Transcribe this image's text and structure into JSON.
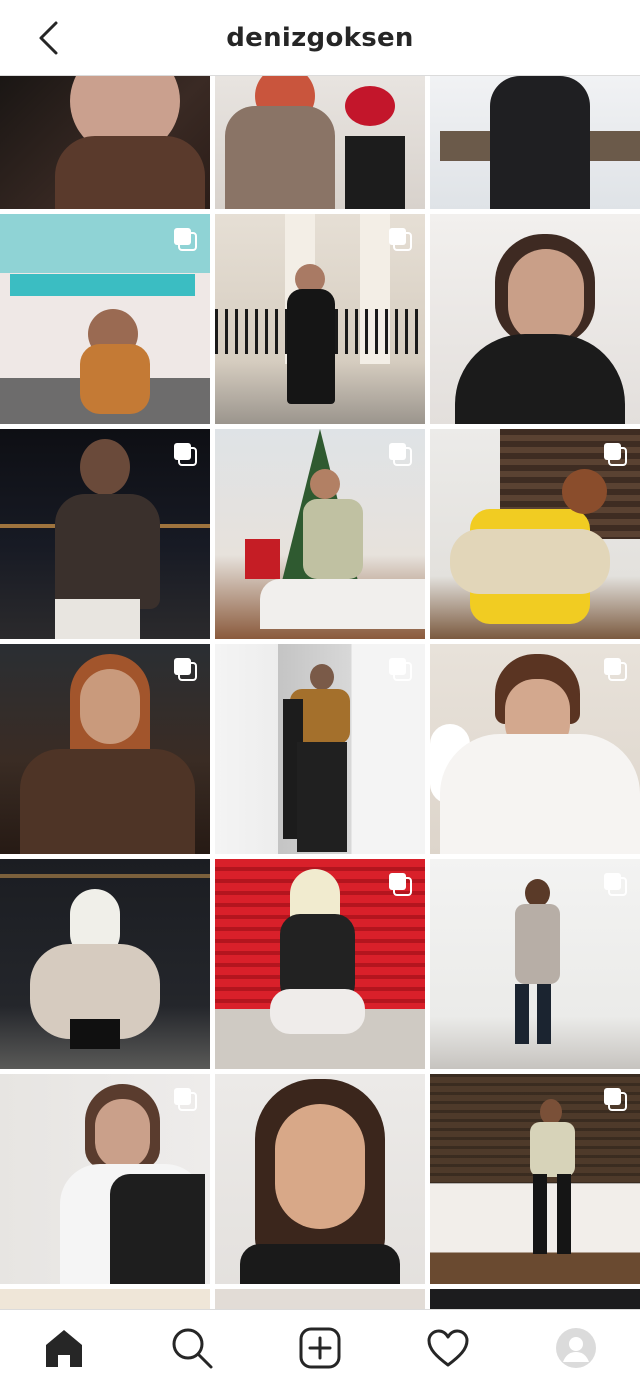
{
  "header": {
    "username": "denizgoksen",
    "back_icon": "chevron-left-icon"
  },
  "grid": {
    "multi_post_icon": "carousel-icon",
    "tiles": [
      {
        "row": 1,
        "col": 1,
        "multi": false
      },
      {
        "row": 1,
        "col": 2,
        "multi": false
      },
      {
        "row": 1,
        "col": 3,
        "multi": false
      },
      {
        "row": 2,
        "col": 1,
        "multi": true
      },
      {
        "row": 2,
        "col": 2,
        "multi": true
      },
      {
        "row": 2,
        "col": 3,
        "multi": false
      },
      {
        "row": 3,
        "col": 1,
        "multi": true
      },
      {
        "row": 3,
        "col": 2,
        "multi": true
      },
      {
        "row": 3,
        "col": 3,
        "multi": true
      },
      {
        "row": 4,
        "col": 1,
        "multi": true
      },
      {
        "row": 4,
        "col": 2,
        "multi": true
      },
      {
        "row": 4,
        "col": 3,
        "multi": true
      },
      {
        "row": 5,
        "col": 1,
        "multi": false
      },
      {
        "row": 5,
        "col": 2,
        "multi": true
      },
      {
        "row": 5,
        "col": 3,
        "multi": true
      },
      {
        "row": 6,
        "col": 1,
        "multi": true
      },
      {
        "row": 6,
        "col": 2,
        "multi": false
      },
      {
        "row": 6,
        "col": 3,
        "multi": true
      },
      {
        "row": 7,
        "col": 1,
        "multi": true
      },
      {
        "row": 7,
        "col": 2,
        "multi": true
      },
      {
        "row": 7,
        "col": 3,
        "multi": false
      }
    ]
  },
  "bottom_nav": {
    "items": [
      {
        "icon": "home-icon",
        "active": true
      },
      {
        "icon": "search-icon",
        "active": false
      },
      {
        "icon": "new-post-icon",
        "active": false
      },
      {
        "icon": "heart-icon",
        "active": false
      },
      {
        "icon": "profile-avatar-icon",
        "active": false
      }
    ]
  },
  "colors": {
    "text": "#262626",
    "border": "#dbdbdb",
    "background": "#ffffff"
  }
}
